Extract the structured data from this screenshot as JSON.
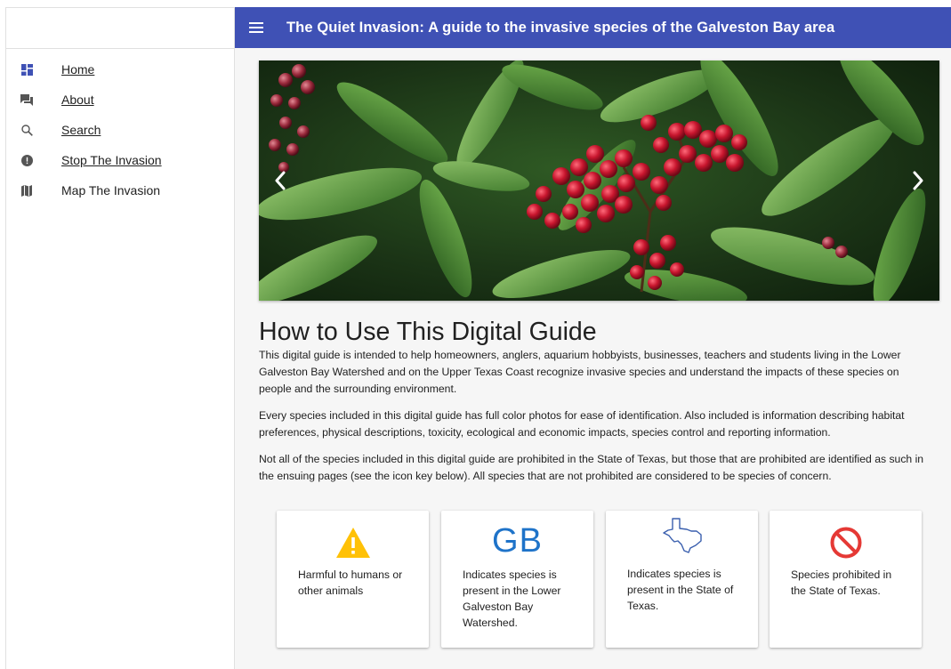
{
  "appbar": {
    "title": "The Quiet Invasion: A guide to the invasive species of the Galveston Bay area"
  },
  "sidebar": {
    "items": [
      {
        "label": "Home",
        "icon": "dashboard-icon"
      },
      {
        "label": "About",
        "icon": "forum-icon"
      },
      {
        "label": "Search",
        "icon": "search-icon"
      },
      {
        "label": "Stop The Invasion",
        "icon": "alert-circle-icon"
      },
      {
        "label": "Map The Invasion",
        "icon": "map-icon"
      }
    ]
  },
  "main": {
    "title": "How to Use This Digital Guide",
    "paragraphs": [
      "This digital guide is intended to help homeowners, anglers, aquarium hobbyists, businesses, teachers and students living in the Lower Galveston Bay Watershed and on the Upper Texas Coast recognize invasive species and understand the impacts of these species on people and the surrounding environment.",
      "Every species included in this digital guide has full color photos for ease of identification. Also included is information describing habitat preferences, physical descriptions, toxicity, ecological and economic impacts, species control and reporting information.",
      "Not all of the species included in this digital guide are prohibited in the State of Texas, but those that are prohibited are identified as such in the ensuing pages (see the icon key below). All species that are not prohibited are considered to be species of concern."
    ],
    "cards": [
      {
        "icon": "warning-icon",
        "text": "Harmful to humans or other animals"
      },
      {
        "icon": "gb-icon",
        "icon_text": "GB",
        "text": "Indicates species is present in the Lower Galveston Bay Watershed."
      },
      {
        "icon": "texas-outline-icon",
        "text": "Indicates species is present in the State of Texas."
      },
      {
        "icon": "prohibited-icon",
        "text": "Species prohibited in the State of Texas."
      }
    ]
  },
  "colors": {
    "appbar": "#3f51b5",
    "nav_icon": "#3f51b5",
    "warning": "#ffc107",
    "gb": "#1e73c9",
    "prohibited": "#e53935"
  }
}
